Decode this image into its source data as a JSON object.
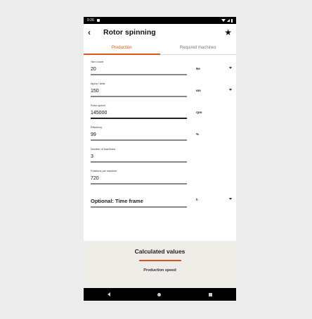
{
  "statusbar": {
    "time": "9:26"
  },
  "appbar": {
    "back_glyph": "‹",
    "title": "Rotor spinning",
    "star_glyph": "★"
  },
  "tabs": [
    {
      "label": "Production",
      "active": true
    },
    {
      "label": "Required machines",
      "active": false
    }
  ],
  "fields": [
    {
      "label": "Yarn count",
      "value": "20",
      "unit": "Ne",
      "has_dropdown": true
    },
    {
      "label": "Alpha / twist",
      "value": "150",
      "unit": "αm",
      "has_dropdown": true
    },
    {
      "label": "Rotor speed",
      "value": "145000",
      "unit": "rpm",
      "has_dropdown": false
    },
    {
      "label": "Efficiency",
      "value": "99",
      "unit": "%",
      "has_dropdown": false
    },
    {
      "label": "Number of machines",
      "value": "3",
      "unit": "",
      "has_dropdown": false
    },
    {
      "label": "Positions per machine",
      "value": "720",
      "unit": "",
      "has_dropdown": false
    }
  ],
  "optional": {
    "label": "Optional: Time frame",
    "unit": "h"
  },
  "calculated": {
    "title": "Calculated values",
    "subtitle": "Production speed"
  },
  "colors": {
    "accent": "#d6561c",
    "calc_bg": "#efede8"
  }
}
